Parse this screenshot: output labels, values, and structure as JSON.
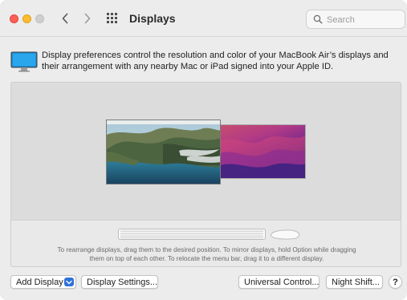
{
  "window": {
    "title": "Displays"
  },
  "search": {
    "placeholder": "Search"
  },
  "description": "Display preferences control the resolution and color of your MacBook Air’s displays and their arrangement with any nearby Mac or iPad signed into your Apple ID.",
  "arrangement": {
    "instructions_line1": "To rearrange displays, drag them to the desired position. To mirror displays, hold Option while dragging",
    "instructions_line2": "them on top of each other. To relocate the menu bar, drag it to a different display."
  },
  "buttons": {
    "add_display": "Add Display",
    "display_settings": "Display Settings...",
    "universal_control": "Universal Control...",
    "night_shift": "Night Shift...",
    "help": "?"
  },
  "icons": {
    "back": "chevron-left-icon",
    "forward": "chevron-right-icon",
    "show_all": "grid-icon",
    "search": "magnifier-icon",
    "display": "display-icon",
    "add_display_menu": "chevron-down-icon"
  },
  "colors": {
    "close": "#fe5f57",
    "minimize": "#febc2e",
    "zoom_inactive": "#cfcfcf",
    "accent": "#2f71d8"
  }
}
